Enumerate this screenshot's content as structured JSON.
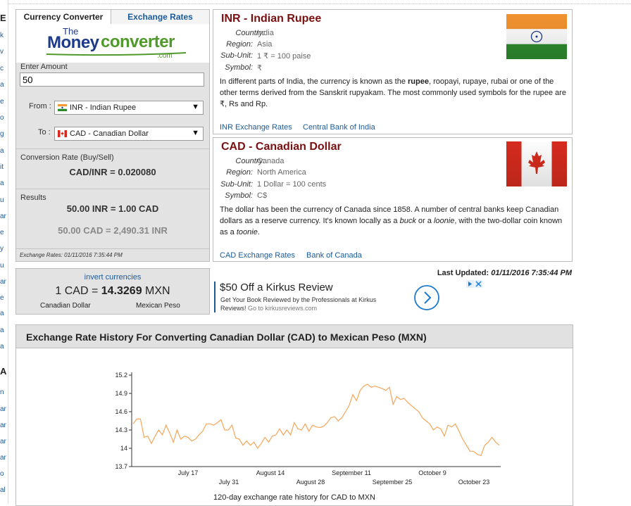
{
  "sidebar": {
    "heading1": "E",
    "heading2": "A",
    "letters": [
      "k",
      "v",
      "c",
      "a",
      "e",
      "o",
      "g",
      "a",
      "it",
      "a",
      "u",
      "ar",
      "e",
      "y",
      "u",
      "ar",
      "e",
      "a",
      "a",
      "a",
      "n",
      "ar",
      "ar",
      "ar",
      "ar",
      "o",
      "al"
    ]
  },
  "converter": {
    "tab_converter": "Currency Converter",
    "tab_rates": "Exchange Rates",
    "logo_the": "The",
    "logo_money": "Money",
    "logo_converter": "converter",
    "logo_com": ".com",
    "amount_label": "Enter Amount",
    "amount_value": "50",
    "from_label": "From :",
    "from_value": "INR - Indian Rupee",
    "to_label": "To :",
    "to_value": "CAD - Canadian Dollar",
    "rate_label": "Conversion Rate (Buy/Sell)",
    "rate_value": "CAD/INR = 0.020080",
    "results_label": "Results",
    "result_primary": "50.00 INR = 1.00 CAD",
    "result_secondary": "50.00 CAD = 2,490.31 INR",
    "footnote": "Exchange Rates: 01/11/2016 7:35:44 PM"
  },
  "invert": {
    "link": "invert currencies",
    "rate_prefix": "1 CAD = ",
    "rate_value": "14.3269",
    "rate_suffix": " MXN",
    "from_name": "Canadian Dollar",
    "to_name": "Mexican Peso"
  },
  "inr": {
    "title": "INR - Indian Rupee",
    "country_label": "Country:",
    "country": "India",
    "region_label": "Region:",
    "region": "Asia",
    "subunit_label": "Sub-Unit:",
    "subunit": "1 ₹ = 100 paise",
    "symbol_label": "Symbol:",
    "symbol": "₹",
    "desc_1": "In different parts of India, the currency is known as the ",
    "desc_bold": "rupee",
    "desc_2": ", roopayi, rupaye, rubai or one of the other terms derived from the Sanskrit rupyakam. The most commonly used symbols for the rupee are ₹, Rs and Rp.",
    "link_rates": "INR Exchange Rates",
    "link_bank": "Central Bank of India"
  },
  "cad": {
    "title": "CAD - Canadian Dollar",
    "country_label": "Country:",
    "country": "Canada",
    "region_label": "Region:",
    "region": "North America",
    "subunit_label": "Sub-Unit:",
    "subunit": "1 Dollar = 100 cents",
    "symbol_label": "Symbol:",
    "symbol": "C$",
    "desc_1": "The dollar has been the currency of Canada since 1858. A number of central banks keep Canadian dollars as a reserve currency. It's known locally as a ",
    "desc_i1": "buck",
    "desc_2": " or a ",
    "desc_i2": "loonie",
    "desc_3": ", with the two-dollar coin known as a ",
    "desc_i3": "toonie",
    "desc_4": ".",
    "link_rates": "CAD Exchange Rates",
    "link_bank": "Bank of Canada"
  },
  "last_updated": {
    "label": "Last Updated: ",
    "value": "01/11/2016 7:35:44 PM"
  },
  "ad": {
    "headline": "$50 Off a Kirkus Review",
    "body": "Get Your Book Reviewed by the Professionals at Kirkus Reviews!",
    "source": " Go to kirkusreviews.com"
  },
  "history": {
    "title": "Exchange Rate History For Converting Canadian Dollar (CAD) to Mexican Peso (MXN)",
    "caption": "120-day exchange rate history for CAD to MXN"
  },
  "colors": {
    "accent": "#1a5a9a",
    "title_red": "#7a1010",
    "line": "#f5a65b"
  },
  "chart_data": {
    "type": "line",
    "title": "",
    "xlabel": "",
    "ylabel": "",
    "ylim": [
      13.7,
      15.2
    ],
    "yticks": [
      "15.2",
      "14.9",
      "14.6",
      "14.3",
      "14",
      "13.7"
    ],
    "xticks_top": [
      "July 17",
      "August 14",
      "September 11",
      "October 9"
    ],
    "xticks_bottom": [
      "July 31",
      "August 28",
      "September 25",
      "October 23"
    ],
    "series": [
      {
        "values": [
          14.4,
          14.48,
          14.48,
          14.18,
          14.2,
          14.08,
          14.2,
          14.3,
          14.22,
          14.38,
          14.25,
          14.1,
          14.3,
          14.15,
          14.2,
          14.18,
          14.12,
          14.15,
          14.22,
          14.28,
          14.4,
          14.4,
          14.38,
          14.42,
          14.47,
          14.3,
          14.3,
          14.38,
          14.17,
          14.15,
          14.05,
          14.12,
          14.05,
          14.1,
          14.0,
          14.08,
          14.18,
          14.1,
          14.2,
          14.22,
          14.32,
          14.22,
          14.3,
          14.22,
          14.42,
          14.32,
          14.3,
          14.4,
          14.28,
          14.38,
          14.35,
          14.34,
          14.36,
          14.42,
          14.5,
          14.52,
          14.45,
          14.5,
          14.6,
          14.7,
          14.88,
          14.78,
          14.95,
          15.02,
          15.05,
          15.0,
          15.02,
          15.0,
          14.98,
          14.95,
          15.0,
          14.72,
          14.85,
          14.8,
          14.82,
          14.75,
          14.7,
          14.65,
          14.6,
          14.5,
          14.45,
          14.4,
          14.3,
          14.35,
          14.32,
          14.2,
          14.38,
          14.35,
          14.4,
          14.28,
          14.15,
          14.05,
          13.95,
          13.95,
          13.9,
          13.88,
          14.05,
          14.1,
          14.18,
          14.1,
          14.05
        ]
      }
    ]
  }
}
